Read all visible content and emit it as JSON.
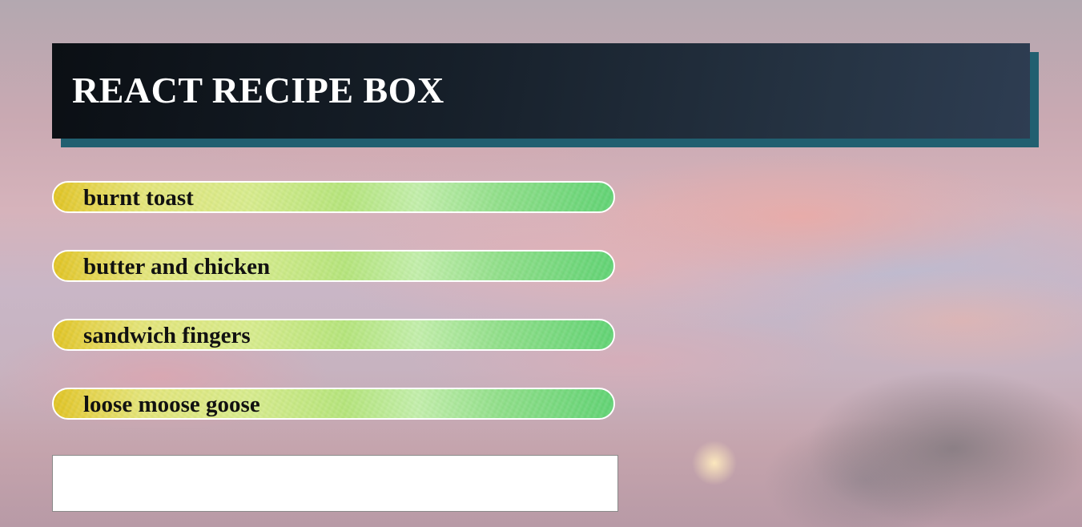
{
  "header": {
    "title": "REACT RECIPE BOX"
  },
  "recipes": [
    {
      "name": "burnt toast"
    },
    {
      "name": "butter and chicken"
    },
    {
      "name": "sandwich fingers"
    },
    {
      "name": "loose moose goose"
    }
  ],
  "new_recipe": {
    "value": "",
    "placeholder": ""
  },
  "colors": {
    "header_bg": "#121a23",
    "header_shadow": "#215f70",
    "header_text": "#ffffff",
    "pill_start": "#e2c21f",
    "pill_end": "#5fd374",
    "pill_border": "#ffffff",
    "recipe_text": "#111111"
  }
}
